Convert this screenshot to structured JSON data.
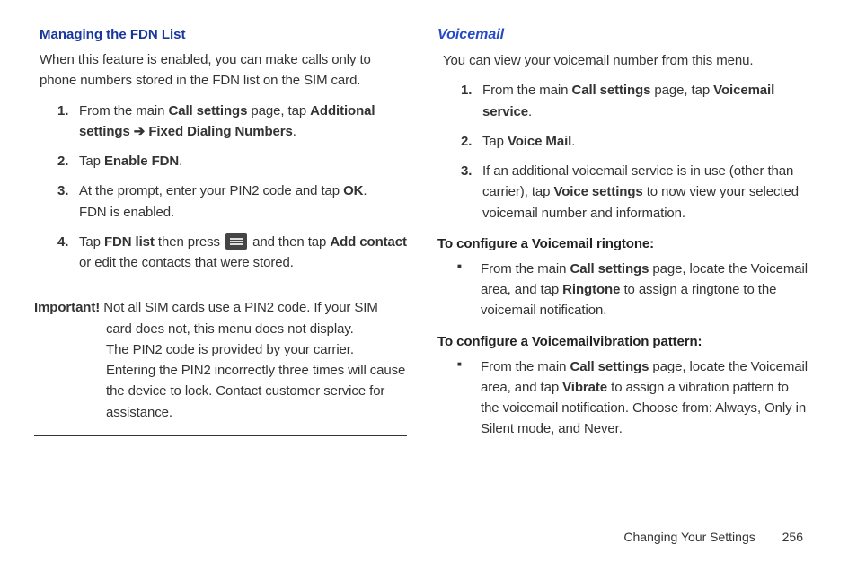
{
  "left": {
    "heading": "Managing the FDN List",
    "intro": "When this feature is enabled, you can make calls only to phone numbers stored in the FDN list on the SIM card.",
    "steps": [
      {
        "num": "1.",
        "pre": "From the main ",
        "b1": "Call settings",
        "mid1": " page, tap ",
        "b2": "Additional settings",
        "arrow": " ➔ ",
        "b3": "Fixed Dialing Numbers",
        "post": "."
      },
      {
        "num": "2.",
        "pre": "Tap ",
        "b1": "Enable FDN",
        "post": "."
      },
      {
        "num": "3.",
        "pre": "At the prompt, enter your PIN2 code and tap ",
        "b1": "OK",
        "post1": ".",
        "post2": "FDN is enabled."
      },
      {
        "num": "4.",
        "pre": "Tap ",
        "b1": "FDN list",
        "mid1": " then press ",
        "mid2": " and then tap ",
        "b2": "Add contact",
        "post": " or edit the contacts that were stored."
      }
    ],
    "important_label": "Important!",
    "important_line1": " Not all SIM cards use a PIN2 code. If your SIM card does not, this menu does not display.",
    "important_line2": "The PIN2 code is provided by your carrier. Entering the PIN2 incorrectly three times will cause the device to lock. Contact customer service for assistance."
  },
  "right": {
    "heading": "Voicemail",
    "intro": "You can view your voicemail number from this menu.",
    "steps": [
      {
        "num": "1.",
        "pre": "From the main ",
        "b1": "Call settings",
        "mid1": " page, tap ",
        "b2": "Voicemail service",
        "post": "."
      },
      {
        "num": "2.",
        "pre": "Tap ",
        "b1": "Voice Mail",
        "post": "."
      },
      {
        "num": "3.",
        "pre": "If an additional voicemail service is in use (other than carrier), tap ",
        "b1": "Voice settings",
        "post": " to now view your selected voicemail number and information."
      }
    ],
    "sub1": "To configure a Voicemail ringtone:",
    "bullet1_pre": "From the main ",
    "bullet1_b1": "Call settings",
    "bullet1_mid": " page, locate the Voicemail area, and tap ",
    "bullet1_b2": "Ringtone",
    "bullet1_post": " to assign a ringtone to the voicemail notification.",
    "sub2": "To configure a Voicemailvibration pattern:",
    "bullet2_pre": "From the main ",
    "bullet2_b1": "Call settings",
    "bullet2_mid": " page, locate the Voicemail area, and tap ",
    "bullet2_b2": "Vibrate",
    "bullet2_post": " to assign a vibration pattern to the voicemail notification. Choose from: Always, Only in Silent mode, and Never."
  },
  "footer": {
    "section": "Changing Your Settings",
    "page": "256"
  }
}
